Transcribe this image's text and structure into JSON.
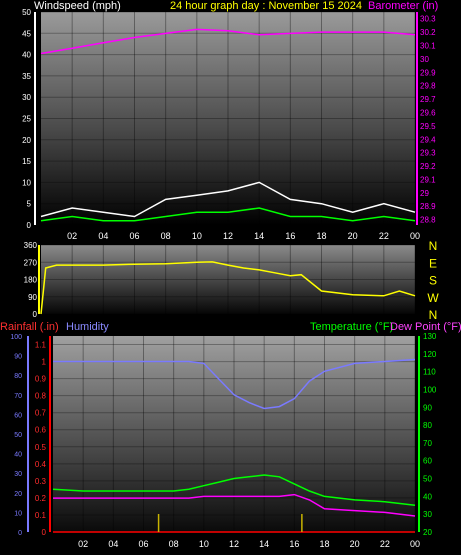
{
  "title": "24 hour graph day : November 15 2024",
  "colors": {
    "background": "#000000",
    "axis_text": "#ffffff",
    "wind_text": "#ffffff",
    "gust": "#ffffff",
    "wind_avg": "#00ff00",
    "barometer": "#ff00ff",
    "direction": "#ffff00",
    "rain": "#ff0000",
    "rain_daily": "#ff2d2d",
    "humidity": "#7a7aff",
    "temperature": "#00ff00",
    "dewpoint": "#ff00ff",
    "rain_marks": "#c8b400"
  },
  "time_ticks": [
    "02",
    "04",
    "06",
    "08",
    "10",
    "12",
    "14",
    "16",
    "18",
    "20",
    "22",
    "00"
  ],
  "chart_data": [
    {
      "id": "wind-barometer",
      "type": "line",
      "ylabel_left": "Windspeed (mph)",
      "ylabel_right": "Barometer (in)",
      "left_ticks": [
        0,
        5,
        10,
        15,
        20,
        25,
        30,
        35,
        40,
        45,
        50
      ],
      "right_ticks": [
        "28.8",
        "28.9",
        "29",
        "29.1",
        "29.2",
        "29.3",
        "29.4",
        "29.5",
        "29.6",
        "29.7",
        "29.8",
        "29.9",
        "30",
        "30.1",
        "30.2",
        "30.3"
      ],
      "left_ylim": [
        0,
        50
      ],
      "right_ylim": [
        28.76,
        30.35
      ],
      "x_hours": [
        0,
        2,
        4,
        6,
        8,
        10,
        12,
        14,
        16,
        18,
        20,
        22,
        24
      ],
      "series": [
        {
          "name": "Barometer",
          "axis": "right",
          "values": [
            30.04,
            30.08,
            30.12,
            30.16,
            30.19,
            30.22,
            30.21,
            30.18,
            30.19,
            30.2,
            30.2,
            30.2,
            30.18
          ]
        },
        {
          "name": "Gust",
          "axis": "left",
          "values": [
            2,
            4,
            3,
            2,
            6,
            7,
            8,
            10,
            6,
            5,
            3,
            5,
            3
          ]
        },
        {
          "name": "Windspeed",
          "axis": "left",
          "values": [
            1,
            2,
            1,
            1,
            2,
            3,
            3,
            4,
            2,
            2,
            1,
            2,
            1
          ]
        }
      ]
    },
    {
      "id": "wind-direction",
      "type": "line",
      "left_ticks": [
        0,
        90,
        180,
        270,
        360
      ],
      "right_ticks": [
        "N",
        "W",
        "S",
        "E",
        "N"
      ],
      "ylim": [
        0,
        360
      ],
      "x_hours": [
        0,
        0.3,
        1,
        2,
        4,
        6,
        8,
        10,
        11,
        12,
        13,
        14,
        15,
        16,
        16.7,
        18,
        20,
        22,
        23,
        24
      ],
      "series": [
        {
          "name": "Direction",
          "values": [
            0,
            240,
            255,
            255,
            255,
            260,
            262,
            270,
            272,
            255,
            240,
            230,
            215,
            200,
            205,
            120,
            100,
            95,
            120,
            95
          ]
        }
      ]
    },
    {
      "id": "temp-hum-rain",
      "type": "line",
      "labels": {
        "rainfall": "Rainfall (.in)",
        "humidity": "Humidity",
        "temperature": "Temperature (°F)",
        "dewpoint": "Dew Point (°F)"
      },
      "humidity_ticks": [
        0,
        10,
        20,
        30,
        40,
        50,
        60,
        70,
        80,
        90,
        100
      ],
      "rain_ticks": [
        "0",
        "0.1",
        "0.2",
        "0.3",
        "0.4",
        "0.5",
        "0.6",
        "0.7",
        "0.8",
        "0.9",
        "1",
        "1.1"
      ],
      "temp_ticks": [
        20,
        30,
        40,
        50,
        60,
        70,
        80,
        90,
        100,
        110,
        120,
        130
      ],
      "humidity_ylim": [
        0,
        100
      ],
      "rain_ylim": [
        0,
        1.15
      ],
      "temp_ylim": [
        20,
        130
      ],
      "x_hours": [
        0,
        2,
        4,
        6,
        8,
        9,
        10,
        11,
        12,
        13,
        14,
        15,
        16,
        17,
        18,
        20,
        22,
        24
      ],
      "series": [
        {
          "name": "Humidity",
          "axis": "left",
          "values": [
            87,
            87,
            87,
            87,
            87,
            87,
            86,
            78,
            70,
            66,
            63,
            64,
            68,
            77,
            82,
            86,
            87,
            88
          ]
        },
        {
          "name": "Temperature",
          "axis": "right",
          "values": [
            44,
            43,
            43,
            43,
            43,
            44,
            46,
            48,
            50,
            51,
            52,
            51,
            47,
            43,
            40,
            38,
            37,
            35
          ]
        },
        {
          "name": "Dew Point",
          "axis": "right",
          "values": [
            39,
            39,
            39,
            39,
            39,
            39,
            40,
            40,
            40,
            40,
            40,
            40,
            41,
            38,
            33,
            32,
            31,
            29
          ]
        },
        {
          "name": "Rainfall",
          "axis": "rain",
          "values": [
            0,
            0,
            0,
            0,
            0,
            0,
            0,
            0,
            0,
            0,
            0,
            0,
            0,
            0,
            0,
            0,
            0,
            0
          ]
        }
      ],
      "rain_marks_hours": [
        7,
        16.5
      ]
    }
  ]
}
